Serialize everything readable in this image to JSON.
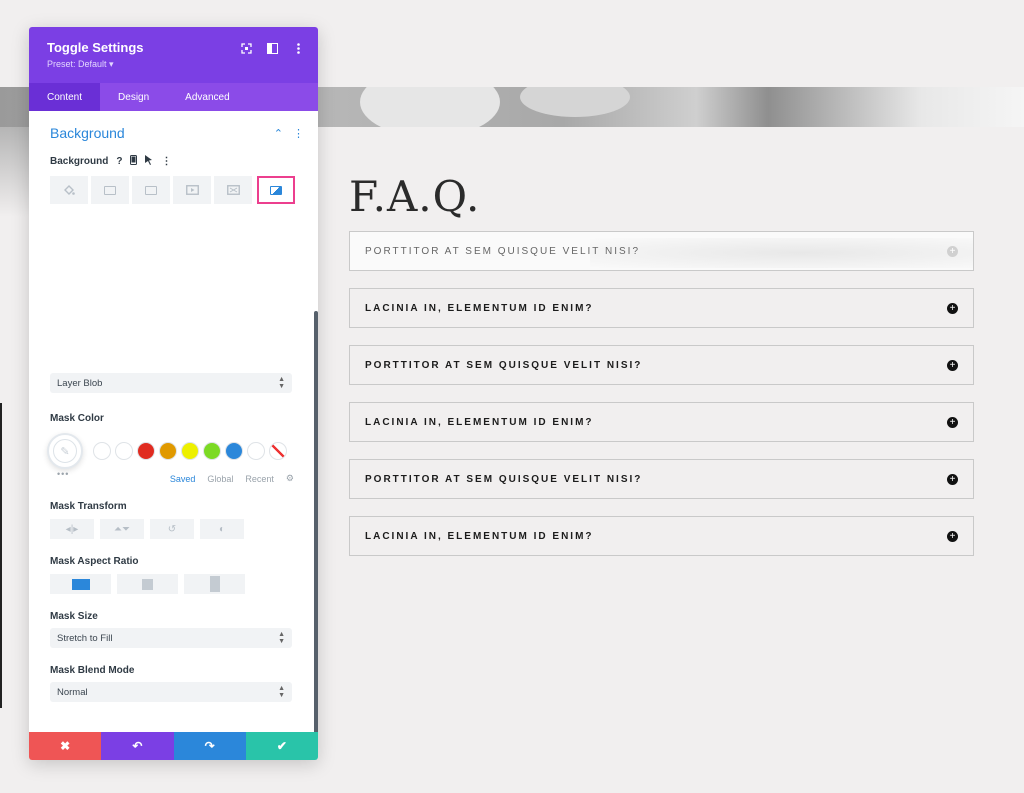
{
  "panel": {
    "title": "Toggle Settings",
    "preset": "Preset: Default ▾",
    "header_icons": [
      "expand-icon",
      "sidebar-icon",
      "more-icon"
    ],
    "tabs": [
      {
        "label": "Content",
        "active": true
      },
      {
        "label": "Design",
        "active": false
      },
      {
        "label": "Advanced",
        "active": false
      }
    ]
  },
  "background": {
    "section_title": "Background",
    "field_label": "Background",
    "help_glyph": "?",
    "mask_style": "Layer Blob",
    "mask_color_label": "Mask Color",
    "swatches": [
      "#ffffff",
      "#ffffff",
      "#e02b20",
      "#e09900",
      "#edf000",
      "#7cda24",
      "#2b87da",
      "#ffffff"
    ],
    "palette_tabs": [
      "Saved",
      "Global",
      "Recent"
    ],
    "mask_transform_label": "Mask Transform",
    "mask_aspect_label": "Mask Aspect Ratio",
    "mask_size_label": "Mask Size",
    "mask_size_value": "Stretch to Fill",
    "mask_blend_label": "Mask Blend Mode",
    "mask_blend_value": "Normal",
    "dots": "•••"
  },
  "footer": {
    "cancel": "✖",
    "undo": "↶",
    "redo": "↷",
    "save": "✔",
    "colors": {
      "cancel": "#ef5555",
      "undo": "#7b3fe4",
      "redo": "#2b87da",
      "save": "#29c4a9"
    }
  },
  "faq": {
    "title": "F.A.Q.",
    "items": [
      {
        "q": "PORTTITOR AT SEM QUISQUE VELIT NISI?",
        "open": true
      },
      {
        "q": "LACINIA IN, ELEMENTUM ID ENIM?",
        "open": false
      },
      {
        "q": "PORTTITOR AT SEM QUISQUE VELIT NISI?",
        "open": false
      },
      {
        "q": "LACINIA IN, ELEMENTUM ID ENIM?",
        "open": false
      },
      {
        "q": "PORTTITOR AT SEM QUISQUE VELIT NISI?",
        "open": false
      },
      {
        "q": "LACINIA IN, ELEMENTUM ID ENIM?",
        "open": false
      }
    ]
  }
}
